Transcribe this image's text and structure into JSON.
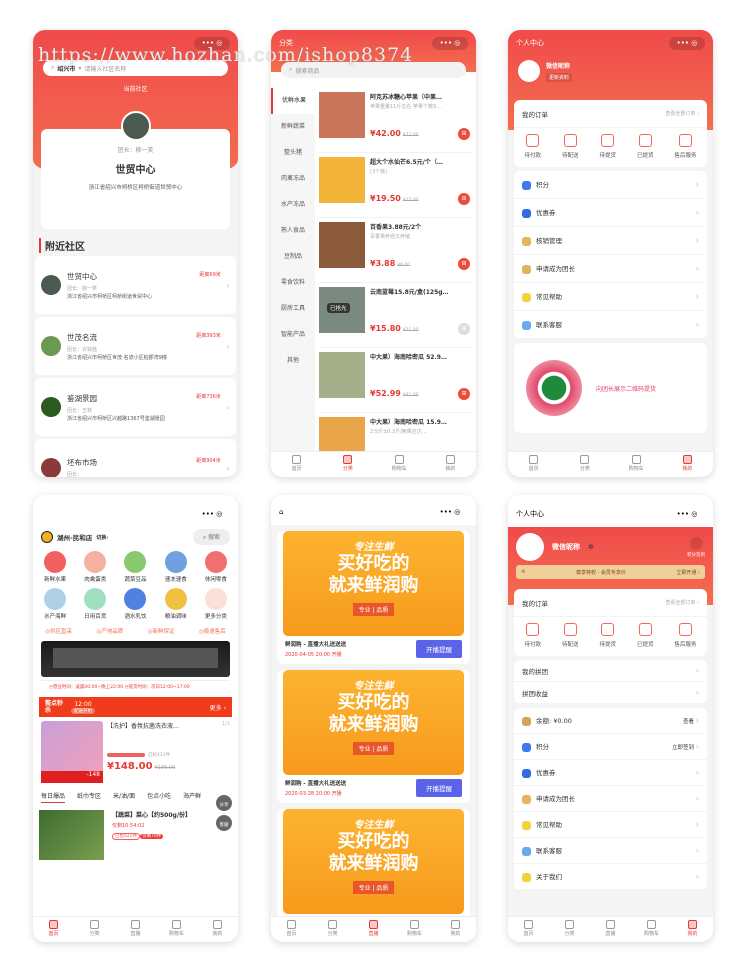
{
  "watermark": "https://www.hozhan.com/ishop8374",
  "community": {
    "search_city": "绍兴市",
    "search_placeholder": "请输入社区名称",
    "current_label": "当前社区",
    "current_leader": "团长：柳一笑",
    "current_name": "世贸中心",
    "current_address": "浙江省绍兴市柯桥区柯桥街道世贸中心",
    "nearby_title": "附近社区",
    "list": [
      {
        "name": "世贸中心",
        "leader": "团长：柳一笑",
        "address": "浙江省绍兴市柯桥区柯桥街道世贸中心",
        "distance": "距离69米"
      },
      {
        "name": "世茂名流",
        "leader": "团长：许锌茜",
        "address": "浙江省绍兴市柯桥区世茂·名流小区柏郡湾9幢",
        "distance": "距离393米"
      },
      {
        "name": "鉴湖景园",
        "leader": "团长：王菲",
        "address": "浙江省绍兴市柯桥区兴越路1367号鉴湖景园",
        "distance": "距离736米"
      },
      {
        "name": "坯布市场",
        "leader": "团长：",
        "address": "",
        "distance": "距离904米"
      }
    ]
  },
  "category": {
    "title": "分类",
    "search_placeholder": "搜索商品",
    "side": [
      "优鲜水果",
      "新鲜蔬菜",
      "整头猪",
      "肉禽冻品",
      "水产冻品",
      "熟人食品",
      "豆制品",
      "零食饮料",
      "厨房工具",
      "智能产品",
      "其他"
    ],
    "active_side": 0,
    "products": [
      {
        "name": "阿克苏冰糖心苹果（中果…",
        "desc": "苹果重量11斤左右 苹果个数9…",
        "price": "¥42.00",
        "orig": "¥72.00",
        "img": "#c9765a"
      },
      {
        "name": "超大个水仙芒6.5元/个（…",
        "desc": "(3个装)",
        "price": "¥19.50",
        "orig": "¥25.00",
        "img": "#f2b53a"
      },
      {
        "name": "百香果3.88元/2个",
        "desc": "百香果养自又养殖",
        "price": "¥3.88",
        "orig": "¥6.00",
        "img": "#8a5a3a"
      },
      {
        "name": "云南蓝莓15.8元/盒(125g…",
        "desc": "",
        "price": "¥15.80",
        "orig": "¥25.00",
        "img": "#7a8a80",
        "soldout": "已抢光"
      },
      {
        "name": "中大果）海南哈密瓜 52.9…",
        "desc": "",
        "price": "¥52.99",
        "orig": "¥92.00",
        "img": "#a5b08a"
      },
      {
        "name": "中大果）海南哈密瓜 15.9…",
        "desc": "2.5斤±0.3斤/两果应达…",
        "price": "",
        "orig": "",
        "img": "#e9a54a"
      }
    ]
  },
  "tabs4": [
    "首页",
    "分类",
    "购物车",
    "我的"
  ],
  "tabs5": [
    "首页",
    "分类",
    "直播",
    "购物车",
    "我的"
  ],
  "profile": {
    "title": "个人中心",
    "nickname": "微信昵称",
    "edit": "更新资料",
    "orders_title": "我的订单",
    "orders_all": "查看全部订单",
    "order_items": [
      "待付款",
      "待配送",
      "待提货",
      "已提货",
      "售后服务"
    ],
    "menu": [
      {
        "label": "积分",
        "color": "#3a7bf0"
      },
      {
        "label": "优惠券",
        "color": "#2f6fe0"
      },
      {
        "label": "核销管理",
        "color": "#e2b55c"
      },
      {
        "label": "申请成为团长",
        "color": "#e2b55c"
      },
      {
        "label": "常见帮助",
        "color": "#f4d03f"
      },
      {
        "label": "联系客服",
        "color": "#6aa8f0"
      }
    ],
    "qr_text": "向团长展示二维码提货"
  },
  "home": {
    "store": "湖州-民和店",
    "switch": "切换",
    "search": "搜索",
    "cats": [
      "新鲜水果",
      "肉禽蛋类",
      "蔬菜豆品",
      "速冻速食",
      "休闲零食",
      "水产海鲜",
      "日用百货",
      "酒水乳饮",
      "粮油调味",
      "更多分类"
    ],
    "features": [
      "供应直采",
      "产地品质",
      "新鲜保证",
      "极速售后"
    ],
    "hours_open": "营业时间：凌晨00:00~晚上22:00",
    "hours_pick": "提货时间：次日12:00~17:00",
    "flash_title": "整点秒杀",
    "flash_time": "12:00",
    "flash_tag": "配送开始",
    "flash_more": "更多",
    "flash_product": "【洗护】香氛抗菌洗衣液…",
    "flash_page": "1/1",
    "flash_sold": "已抢413件",
    "flash_price": "¥148.00",
    "flash_orig": "¥186.00",
    "float_share": "分享",
    "float_service": "客服",
    "tabs": [
      "每日爆品",
      "纸巾专区",
      "米/油/面",
      "包点小吃",
      "海产鲜"
    ],
    "item_name": "【蔬菜】菜心【约500g/份】",
    "item_timer": "仅剩10:54:02",
    "item_sold": "已售622件",
    "item_left": "仅剩70件"
  },
  "live": {
    "banner_slogan": "专注生鲜",
    "banner_line1": "买好吃的",
    "banner_line2": "就来鲜润购",
    "banner_tag": "专业 | 品质",
    "items": [
      {
        "title": "鲜润购 - 直播大礼送送送",
        "time": "2020-04-05 20:00 开播",
        "button": "开播提醒"
      },
      {
        "title": "鲜润购 - 直播大礼送送送",
        "time": "2020-03-28 20:00 开播",
        "button": "开播提醒"
      }
    ]
  },
  "profile2": {
    "title": "个人中心",
    "nickname": "微信昵称",
    "sign": "积分签到",
    "vip": "尊享特权 · 会员专享价",
    "vip_btn": "立即开通",
    "orders_title": "我的订单",
    "orders_all": "查看全部订单",
    "group": [
      "我的拼团",
      "拼团收益"
    ],
    "menu": [
      {
        "label": "余额: ¥0.00",
        "right": "查看",
        "color": "#d9a25a"
      },
      {
        "label": "积分",
        "right": "立即签到",
        "color": "#3a7bf0"
      },
      {
        "label": "优惠券",
        "right": "",
        "color": "#2f6fe0"
      },
      {
        "label": "申请成为团长",
        "right": "",
        "color": "#e2b55c"
      },
      {
        "label": "常见帮助",
        "right": "",
        "color": "#f4d03f"
      },
      {
        "label": "联系客服",
        "right": "",
        "color": "#6aa8f0"
      },
      {
        "label": "关于我们",
        "right": "",
        "color": "#f4d03f"
      }
    ]
  },
  "colors": {
    "brand": "#e53935",
    "live_button": "#5b63e8",
    "banner": "#f9a623"
  }
}
